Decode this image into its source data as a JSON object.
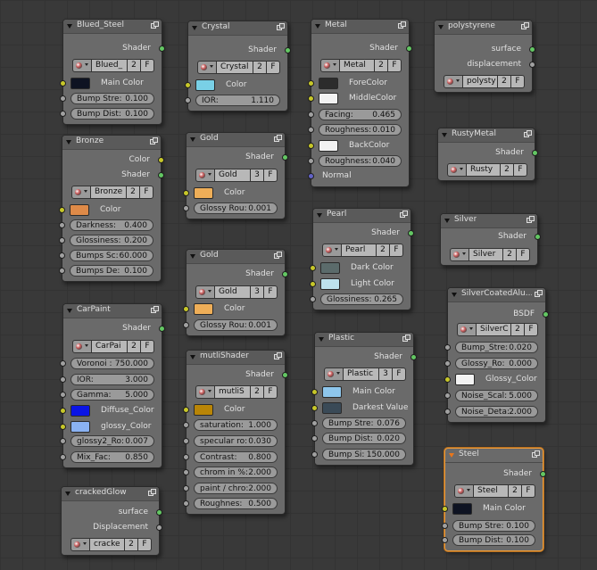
{
  "nodes": [
    {
      "id": "blued-steel",
      "title": "Blued_Steel",
      "rows": [
        {
          "kind": "output",
          "label": "Shader",
          "socket": "green"
        },
        {
          "kind": "group",
          "name": "Blued_",
          "users": "2",
          "fake": "F"
        },
        {
          "kind": "color",
          "label": "Main Color",
          "color": "#0e1322",
          "socket": "yellow"
        },
        {
          "kind": "field",
          "label": "Bump Stre:",
          "value": "0.100",
          "socket": "grey"
        },
        {
          "kind": "field",
          "label": "Bump Dist:",
          "value": "0.100",
          "socket": "grey"
        }
      ]
    },
    {
      "id": "crystal",
      "title": "Crystal",
      "rows": [
        {
          "kind": "output",
          "label": "Shader",
          "socket": "green"
        },
        {
          "kind": "group",
          "name": "Crystal",
          "users": "2",
          "fake": "F"
        },
        {
          "kind": "color",
          "label": "Color",
          "color": "#79d0e6",
          "socket": "yellow"
        },
        {
          "kind": "field",
          "label": "IOR:",
          "value": "1.110",
          "socket": "grey"
        }
      ]
    },
    {
      "id": "metal",
      "title": "Metal",
      "rows": [
        {
          "kind": "output",
          "label": "Shader",
          "socket": "green"
        },
        {
          "kind": "group",
          "name": "Metal",
          "users": "2",
          "fake": "F"
        },
        {
          "kind": "color",
          "label": "ForeColor",
          "color": "#2c2c2c",
          "socket": "yellow"
        },
        {
          "kind": "color",
          "label": "MiddleColor",
          "color": "#f2f2f2",
          "socket": "yellow"
        },
        {
          "kind": "field",
          "label": "Facing:",
          "value": "0.465",
          "socket": "grey"
        },
        {
          "kind": "field",
          "label": "Roughness:",
          "value": "0.010",
          "socket": "grey"
        },
        {
          "kind": "color",
          "label": "BackColor",
          "color": "#f2f2f2",
          "socket": "yellow"
        },
        {
          "kind": "field",
          "label": "Roughness:",
          "value": "0.040",
          "socket": "grey"
        },
        {
          "kind": "input",
          "label": "Normal",
          "socket": "blue"
        }
      ]
    },
    {
      "id": "polystyrene",
      "title": "polystyrene",
      "rows": [
        {
          "kind": "output",
          "label": "surface",
          "socket": "green"
        },
        {
          "kind": "output",
          "label": "displacement",
          "socket": "grey"
        },
        {
          "kind": "group",
          "name": "polysty",
          "users": "2",
          "fake": "F"
        }
      ]
    },
    {
      "id": "bronze",
      "title": "Bronze",
      "rows": [
        {
          "kind": "output",
          "label": "Color",
          "socket": "yellow"
        },
        {
          "kind": "output",
          "label": "Shader",
          "socket": "green"
        },
        {
          "kind": "group",
          "name": "Bronze",
          "users": "2",
          "fake": "F"
        },
        {
          "kind": "color",
          "label": "Color",
          "color": "#de8a48",
          "socket": "yellow"
        },
        {
          "kind": "field",
          "label": "Darkness:",
          "value": "0.400",
          "socket": "grey"
        },
        {
          "kind": "field",
          "label": "Glossiness:",
          "value": "0.200",
          "socket": "grey"
        },
        {
          "kind": "field",
          "label": "Bumps Sc:",
          "value": "60.000",
          "socket": "grey"
        },
        {
          "kind": "field",
          "label": "Bumps De:",
          "value": "0.100",
          "socket": "grey"
        }
      ]
    },
    {
      "id": "gold-1",
      "title": "Gold",
      "rows": [
        {
          "kind": "output",
          "label": "Shader",
          "socket": "green"
        },
        {
          "kind": "group",
          "name": "Gold",
          "users": "3",
          "fake": "F"
        },
        {
          "kind": "color",
          "label": "Color",
          "color": "#eeae58",
          "socket": "yellow"
        },
        {
          "kind": "field",
          "label": "Glossy Rou:",
          "value": "0.001",
          "socket": "grey"
        }
      ]
    },
    {
      "id": "rusty-metal",
      "title": "RustyMetal",
      "rows": [
        {
          "kind": "output",
          "label": "Shader",
          "socket": "green"
        },
        {
          "kind": "group",
          "name": "Rusty",
          "users": "2",
          "fake": "F"
        }
      ]
    },
    {
      "id": "pearl",
      "title": "Pearl",
      "rows": [
        {
          "kind": "output",
          "label": "Shader",
          "socket": "green"
        },
        {
          "kind": "group",
          "name": "Pearl",
          "users": "2",
          "fake": "F"
        },
        {
          "kind": "color",
          "label": "Dark Color",
          "color": "#5b6b6b",
          "socket": "yellow"
        },
        {
          "kind": "color",
          "label": "Light Color",
          "color": "#bde2ee",
          "socket": "yellow"
        },
        {
          "kind": "field",
          "label": "Glossiness:",
          "value": "0.265",
          "socket": "grey"
        }
      ]
    },
    {
      "id": "silver",
      "title": "Silver",
      "rows": [
        {
          "kind": "output",
          "label": "Shader",
          "socket": "green"
        },
        {
          "kind": "group",
          "name": "Silver",
          "users": "2",
          "fake": "F"
        }
      ]
    },
    {
      "id": "gold-2",
      "title": "Gold",
      "rows": [
        {
          "kind": "output",
          "label": "Shader",
          "socket": "green"
        },
        {
          "kind": "group",
          "name": "Gold",
          "users": "3",
          "fake": "F"
        },
        {
          "kind": "color",
          "label": "Color",
          "color": "#eeae58",
          "socket": "yellow"
        },
        {
          "kind": "field",
          "label": "Glossy Rou:",
          "value": "0.001",
          "socket": "grey"
        }
      ]
    },
    {
      "id": "silver-coated",
      "title": "SilverCoatedAlu...",
      "rows": [
        {
          "kind": "output",
          "label": "BSDF",
          "socket": "green"
        },
        {
          "kind": "group",
          "name": "SilverC",
          "users": "2",
          "fake": "F"
        },
        {
          "kind": "field",
          "label": "Bump_Stre:",
          "value": "0.020",
          "socket": "grey"
        },
        {
          "kind": "field",
          "label": "Glossy_Ro:",
          "value": "0.000",
          "socket": "grey"
        },
        {
          "kind": "color",
          "label": "Glossy_Color",
          "color": "#f2f2f2",
          "socket": "yellow"
        },
        {
          "kind": "field",
          "label": "Noise_Scal:",
          "value": "5.000",
          "socket": "grey"
        },
        {
          "kind": "field",
          "label": "Noise_Deta:",
          "value": "2.000",
          "socket": "grey"
        }
      ]
    },
    {
      "id": "carpaint",
      "title": "CarPaint",
      "rows": [
        {
          "kind": "output",
          "label": "Shader",
          "socket": "green"
        },
        {
          "kind": "group",
          "name": "CarPai",
          "users": "2",
          "fake": "F"
        },
        {
          "kind": "field",
          "label": "Voronoi :",
          "value": "750.000",
          "socket": "grey"
        },
        {
          "kind": "field",
          "label": "IOR:",
          "value": "3.000",
          "socket": "grey"
        },
        {
          "kind": "field",
          "label": "Gamma:",
          "value": "5.000",
          "socket": "grey"
        },
        {
          "kind": "color",
          "label": "Diffuse_Color",
          "color": "#0a14e6",
          "socket": "yellow"
        },
        {
          "kind": "color",
          "label": "glossy_Color",
          "color": "#8ab2f2",
          "socket": "yellow"
        },
        {
          "kind": "field",
          "label": "glossy2_Ro:",
          "value": "0.007",
          "socket": "grey"
        },
        {
          "kind": "field",
          "label": "Mix_Fac:",
          "value": "0.850",
          "socket": "grey"
        }
      ]
    },
    {
      "id": "mutli-shader",
      "title": "mutliShader",
      "rows": [
        {
          "kind": "output",
          "label": "Shader",
          "socket": "green"
        },
        {
          "kind": "group",
          "name": "mutliS",
          "users": "2",
          "fake": "F"
        },
        {
          "kind": "color",
          "label": "Color",
          "color": "#b98507",
          "socket": "yellow"
        },
        {
          "kind": "field",
          "label": "saturation:",
          "value": "1.000",
          "socket": "grey"
        },
        {
          "kind": "field",
          "label": "specular ro:",
          "value": "0.030",
          "socket": "grey"
        },
        {
          "kind": "field",
          "label": "Contrast:",
          "value": "0.800",
          "socket": "grey"
        },
        {
          "kind": "field",
          "label": "chrom in %:",
          "value": "2.000",
          "socket": "grey"
        },
        {
          "kind": "field",
          "label": "paint / chro:",
          "value": "2.000",
          "socket": "grey"
        },
        {
          "kind": "field",
          "label": "Roughnes:",
          "value": "0.500",
          "socket": "grey"
        }
      ]
    },
    {
      "id": "plastic",
      "title": "Plastic",
      "rows": [
        {
          "kind": "output",
          "label": "Shader",
          "socket": "green"
        },
        {
          "kind": "group",
          "name": "Plastic",
          "users": "3",
          "fake": "F"
        },
        {
          "kind": "color",
          "label": "Main Color",
          "color": "#8ec6ec",
          "socket": "yellow"
        },
        {
          "kind": "color",
          "label": "Darkest Value",
          "color": "#3a4a57",
          "socket": "yellow"
        },
        {
          "kind": "field",
          "label": "Bump Stre:",
          "value": "0.076",
          "socket": "grey"
        },
        {
          "kind": "field",
          "label": "Bump Dist:",
          "value": "0.020",
          "socket": "grey"
        },
        {
          "kind": "field",
          "label": "Bump Si:",
          "value": "150.000",
          "socket": "grey"
        }
      ]
    },
    {
      "id": "steel",
      "title": "Steel",
      "selected": true,
      "rows": [
        {
          "kind": "output",
          "label": "Shader",
          "socket": "green"
        },
        {
          "kind": "group",
          "name": "Steel",
          "users": "2",
          "fake": "F"
        },
        {
          "kind": "color",
          "label": "Main Color",
          "color": "#0e1322",
          "socket": "yellow"
        },
        {
          "kind": "field",
          "label": "Bump Stre:",
          "value": "0.100",
          "socket": "grey"
        },
        {
          "kind": "field",
          "label": "Bump Dist:",
          "value": "0.100",
          "socket": "grey"
        }
      ]
    },
    {
      "id": "cracked-glow",
      "title": "crackedGlow",
      "rows": [
        {
          "kind": "output",
          "label": "surface",
          "socket": "green"
        },
        {
          "kind": "output",
          "label": "Displacement",
          "socket": "grey"
        },
        {
          "kind": "group",
          "name": "cracke",
          "users": "2",
          "fake": "F"
        }
      ]
    }
  ]
}
